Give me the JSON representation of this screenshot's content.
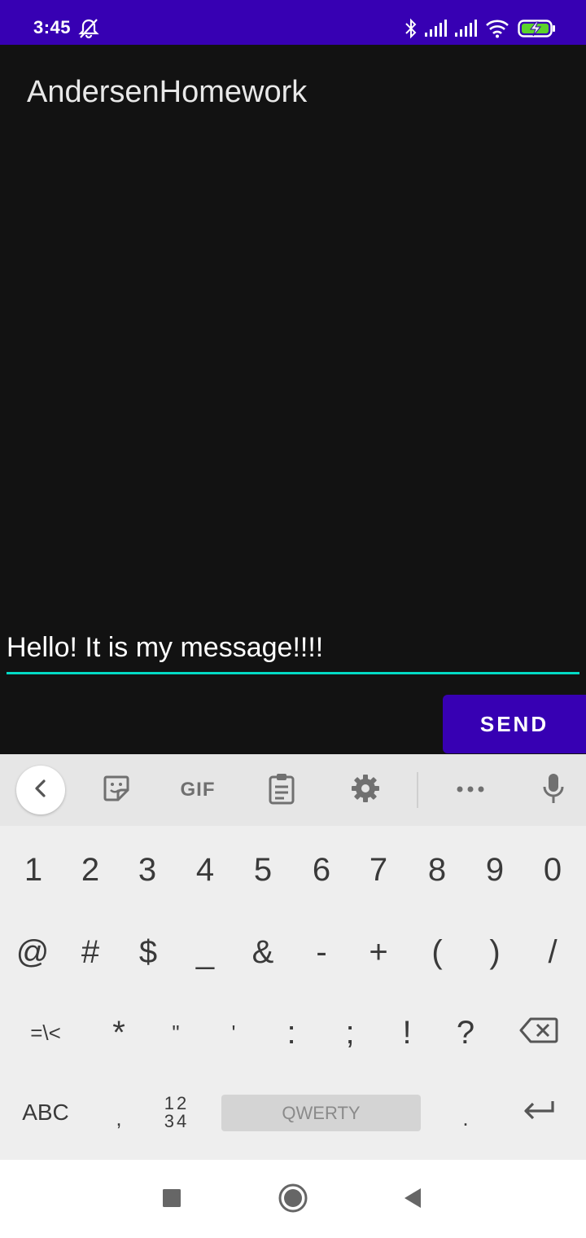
{
  "status_bar": {
    "time": "3:45",
    "icons": [
      "mute-icon",
      "bluetooth-icon",
      "signal-icon",
      "signal-icon",
      "wifi-icon",
      "battery-charging-icon"
    ],
    "color": "#3700b3"
  },
  "app": {
    "title": "AndersenHomework",
    "message_value": "Hello! It is my message!!!!",
    "send_label": "SEND",
    "accent_color": "#03dac5",
    "primary_color": "#3700b3"
  },
  "keyboard": {
    "toolbar": {
      "gif_label": "GIF",
      "icons": [
        "back-icon",
        "sticker-icon",
        "gif-icon",
        "clipboard-icon",
        "settings-icon",
        "more-icon",
        "mic-icon"
      ]
    },
    "row1": [
      "1",
      "2",
      "3",
      "4",
      "5",
      "6",
      "7",
      "8",
      "9",
      "0"
    ],
    "row2": [
      "@",
      "#",
      "$",
      "_",
      "&",
      "-",
      "+",
      "(",
      ")",
      "/"
    ],
    "row3": [
      "=\\<",
      "*",
      "\"",
      "'",
      ":",
      ";",
      "!",
      "?"
    ],
    "row4": {
      "abc": "ABC",
      "comma": ",",
      "numpad_top": "12",
      "numpad_bottom": "34",
      "space": "QWERTY",
      "period": "."
    }
  },
  "nav_bar": {
    "icons": [
      "recents-icon",
      "home-icon",
      "back-icon"
    ]
  }
}
